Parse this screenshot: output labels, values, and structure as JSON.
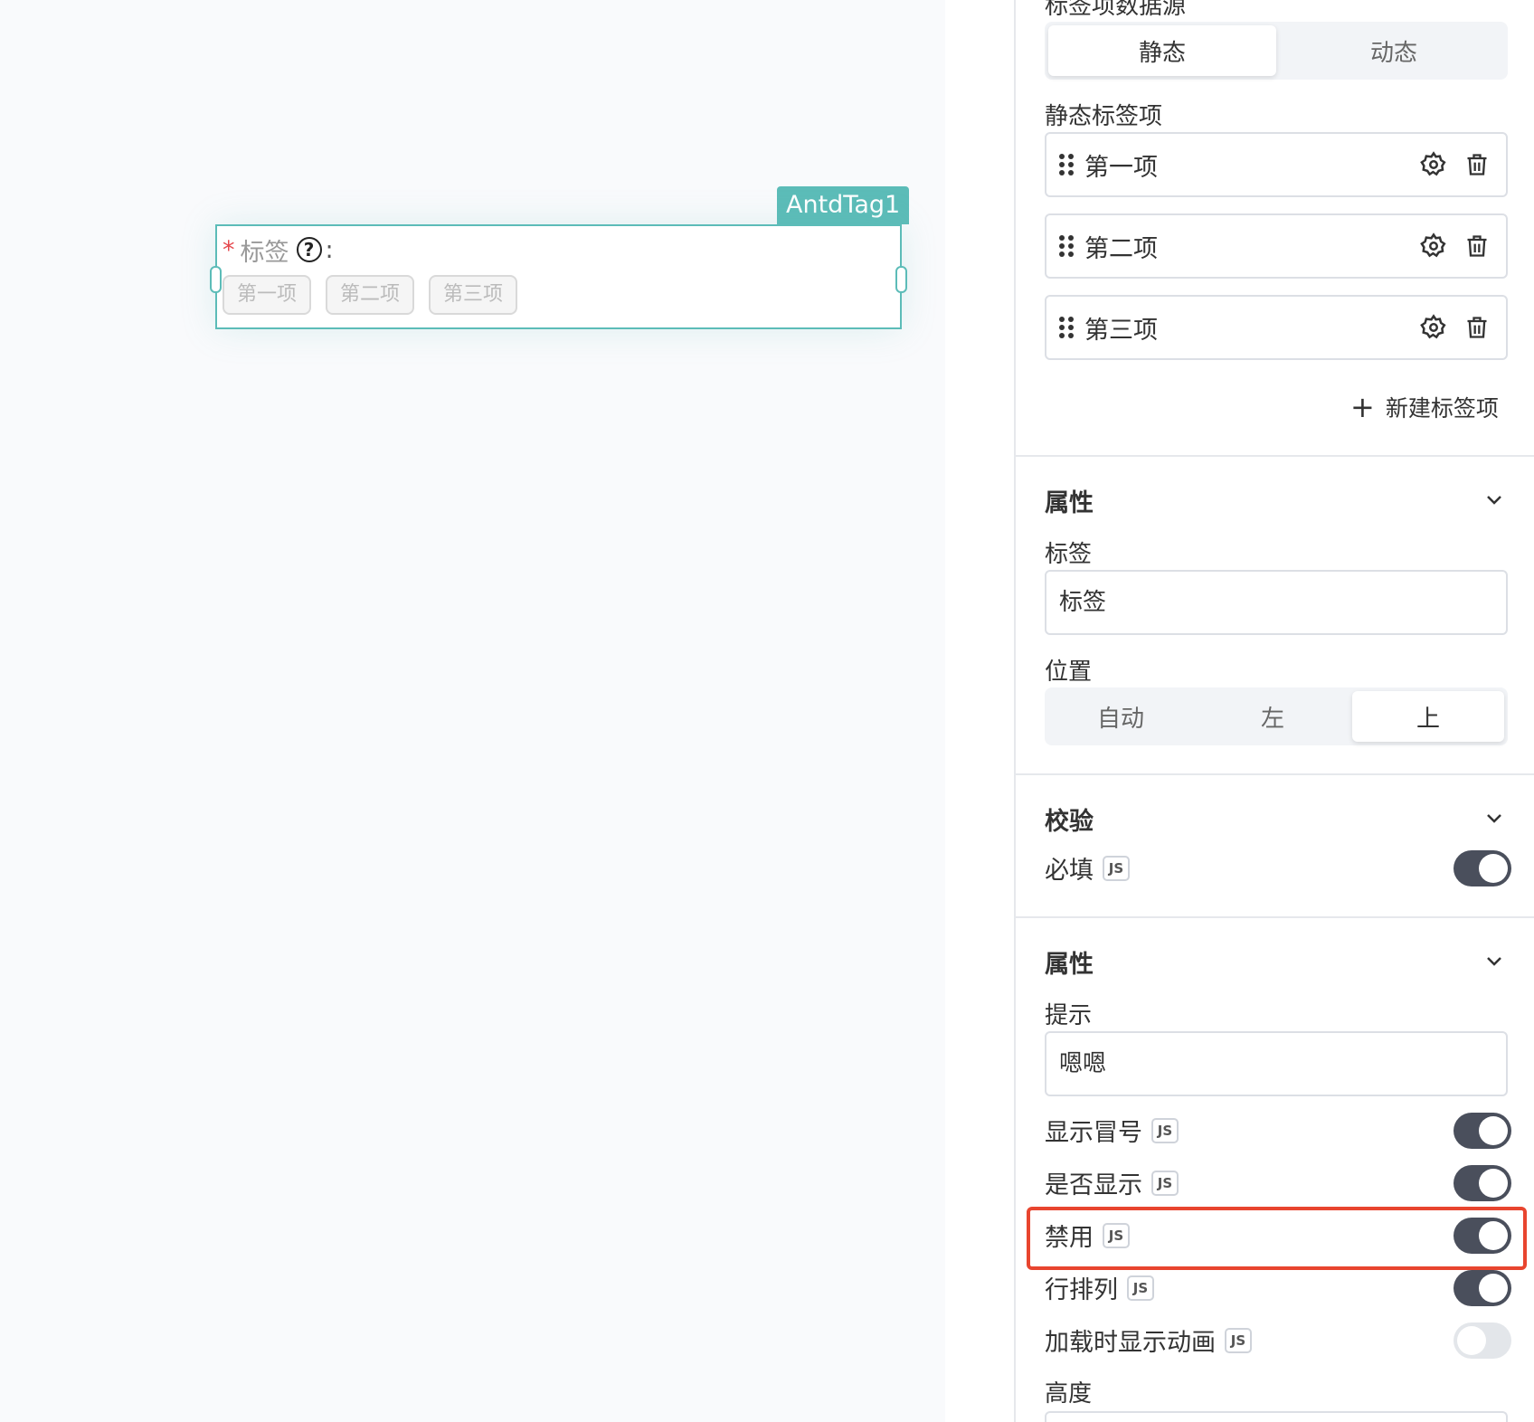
{
  "canvas": {
    "widget_name": "AntdTag1",
    "label_star": "*",
    "label": "标签",
    "help_icon": "?",
    "colon": ":",
    "tags": [
      "第一项",
      "第二项",
      "第三项"
    ]
  },
  "panel": {
    "datasource_label": "标签项数据源",
    "datasource_options": [
      "静态",
      "动态"
    ],
    "datasource_selected": "静态",
    "static_items_label": "静态标签项",
    "static_items": [
      "第一项",
      "第二项",
      "第三项"
    ],
    "add_item": "新建标签项",
    "section_props": {
      "title": "属性",
      "label_field": "标签",
      "label_value": "标签",
      "position_label": "位置",
      "position_options": [
        "自动",
        "左",
        "上"
      ],
      "position_selected": "上"
    },
    "section_validation": {
      "title": "校验",
      "required_label": "必填",
      "required_on": true
    },
    "section_props2": {
      "title": "属性",
      "tooltip_label": "提示",
      "tooltip_value": "嗯嗯",
      "show_colon": "显示冒号",
      "visible": "是否显示",
      "disabled": "禁用",
      "row_layout": "行排列",
      "loading_animation": "加载时显示动画",
      "height": "高度",
      "toggles": {
        "show_colon": true,
        "visible": true,
        "disabled": true,
        "row_layout": true,
        "loading_animation": false
      }
    },
    "js_badge": "JS"
  },
  "colors": {
    "accent": "#5cbcb8",
    "highlight": "#e8452f",
    "toggle_on": "#4a4f5c"
  }
}
